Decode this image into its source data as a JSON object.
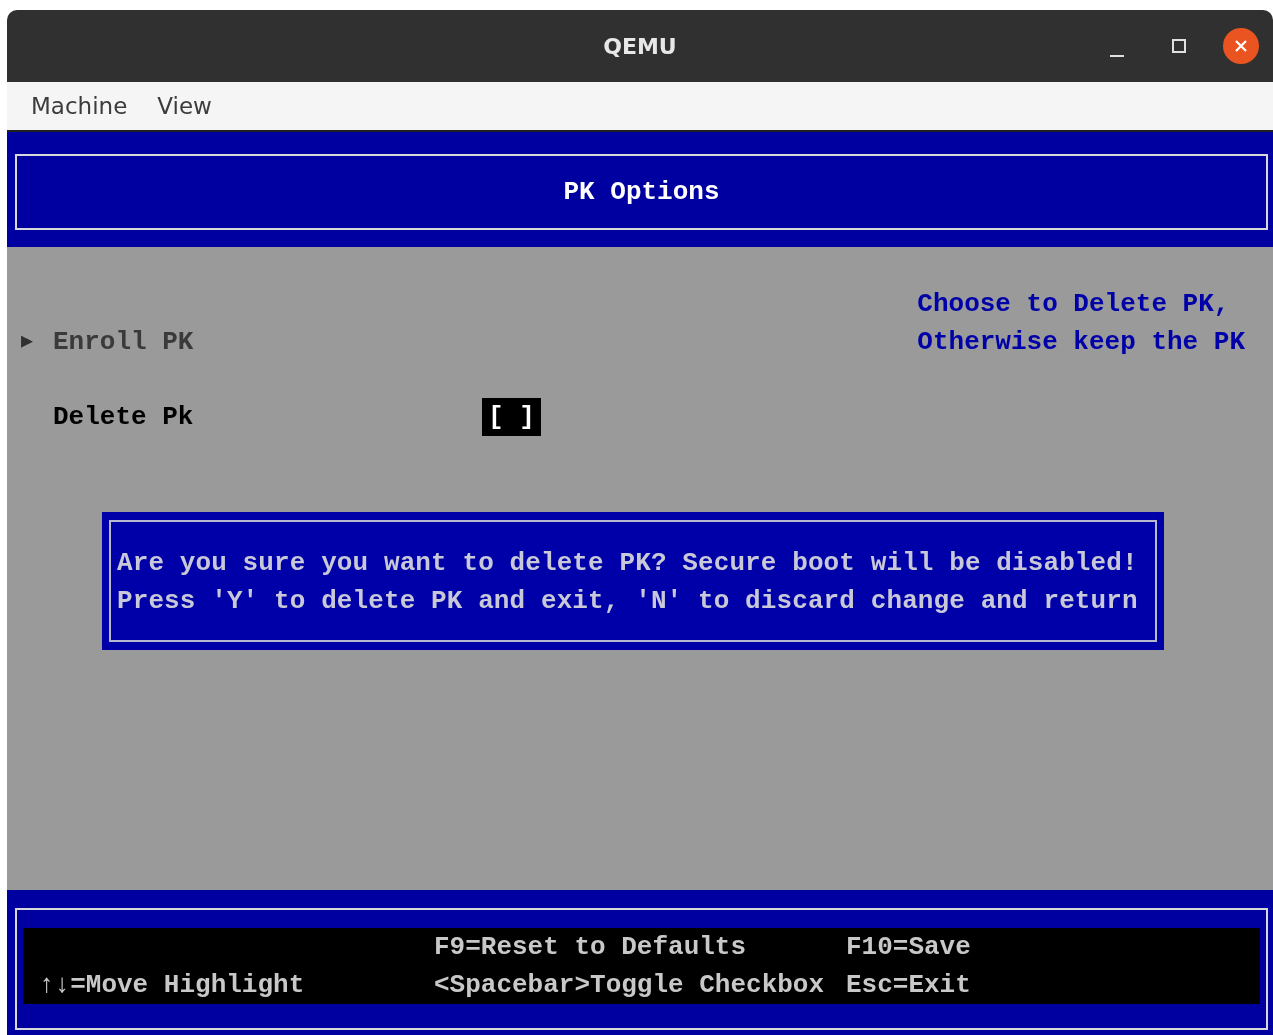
{
  "window": {
    "title": "QEMU"
  },
  "menu": [
    "Machine",
    "View"
  ],
  "header": {
    "title": "PK Options"
  },
  "items": [
    {
      "kind": "submenu",
      "marker": "▶",
      "label": "Enroll PK",
      "disabled": true
    },
    {
      "kind": "checkbox",
      "label": "Delete Pk",
      "value": "[ ]",
      "disabled": false,
      "highlighted": true
    }
  ],
  "help": [
    "Choose to Delete PK,",
    "Otherwise keep the PK"
  ],
  "dialog": {
    "lines": [
      "Are you sure you want to delete PK? Secure boot will be disabled!",
      "Press 'Y' to delete PK and exit, 'N' to discard change and return"
    ]
  },
  "footer": {
    "column_1": [
      "↑↓=Move Highlight"
    ],
    "column_2": [
      "F9=Reset to Defaults",
      "<Spacebar>Toggle Checkbox"
    ],
    "column_3": [
      "F10=Save",
      "Esc=Exit"
    ]
  }
}
